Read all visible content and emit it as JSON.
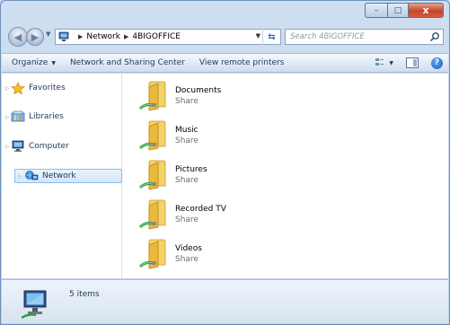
{
  "window": {
    "caption_buttons": {
      "minimize": "–",
      "maximize": "□",
      "close": "x"
    }
  },
  "navigation": {
    "back_icon": "back-arrow-icon",
    "forward_icon": "forward-arrow-icon",
    "address": {
      "icon": "network-icon",
      "crumbs": [
        "Network",
        "4BIGOFFICE"
      ]
    },
    "search_placeholder": "Search 4BIGOFFICE"
  },
  "command_bar": {
    "organize": "Organize",
    "network_sharing": "Network and Sharing Center",
    "view_printers": "View remote printers"
  },
  "nav_pane": {
    "items": [
      {
        "label": "Favorites",
        "icon": "star-icon"
      },
      {
        "label": "Libraries",
        "icon": "libraries-icon"
      },
      {
        "label": "Computer",
        "icon": "computer-icon"
      },
      {
        "label": "Network",
        "icon": "network-icon",
        "selected": true
      }
    ]
  },
  "files": [
    {
      "name": "Documents",
      "type": "Share"
    },
    {
      "name": "Music",
      "type": "Share"
    },
    {
      "name": "Pictures",
      "type": "Share"
    },
    {
      "name": "Recorded TV",
      "type": "Share"
    },
    {
      "name": "Videos",
      "type": "Share"
    }
  ],
  "status_bar": {
    "text": "5 items",
    "icon": "network-computer-icon"
  },
  "colors": {
    "frame": "#bcd1ea",
    "selection": "#d2e7fb",
    "folder": "#f0c94a",
    "share_pipe": "#2e9b3a"
  }
}
